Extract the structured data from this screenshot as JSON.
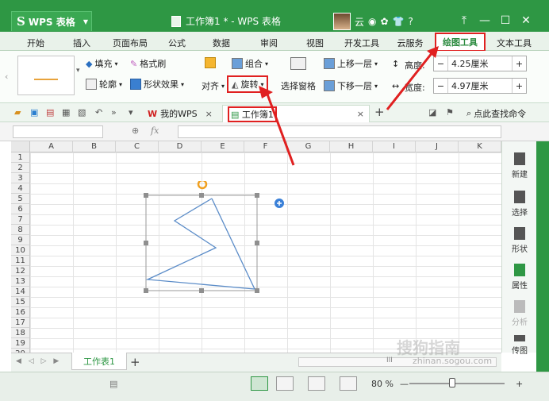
{
  "titlebar": {
    "app_name": "WPS 表格",
    "doc_title": "工作簿1 * - WPS 表格",
    "user_name": "云",
    "help": "?",
    "minimize": "—",
    "maximize": "☐",
    "close": "✕"
  },
  "tabs": [
    "开始",
    "插入",
    "页面布局",
    "公式",
    "数据",
    "审阅",
    "视图",
    "开发工具",
    "云服务",
    "绘图工具",
    "文本工具"
  ],
  "active_tab": "绘图工具",
  "ribbon": {
    "fill": "填充",
    "format_brush": "格式刷",
    "outline": "轮廓",
    "shape_effect": "形状效果",
    "align": "对齐",
    "group": "组合",
    "rotate": "旋转",
    "selection_pane": "选择窗格",
    "bring_forward": "上移一层",
    "send_backward": "下移一层",
    "height_label": "高度:",
    "height_value": "4.25厘米",
    "width_label": "宽度:",
    "width_value": "4.97厘米",
    "minus": "−",
    "plus": "+"
  },
  "doctabs": {
    "my_wps": "我的WPS",
    "workbook": "工作簿1",
    "close": "×",
    "add": "+",
    "search": "点此查找命令"
  },
  "formula": {
    "fx": "fx"
  },
  "columns": [
    "A",
    "B",
    "C",
    "D",
    "E",
    "F",
    "G",
    "H",
    "I",
    "J",
    "K"
  ],
  "rows": [
    "1",
    "2",
    "3",
    "4",
    "5",
    "6",
    "7",
    "8",
    "9",
    "10",
    "11",
    "12",
    "13",
    "14",
    "15",
    "16",
    "17",
    "18",
    "19",
    "20"
  ],
  "sidepanel": [
    "新建",
    "选择",
    "形状",
    "属性",
    "分析",
    "传图"
  ],
  "sheet_tabs": {
    "sheet1": "工作表1",
    "add": "+",
    "nav": "◀ ◁ ▷ ▶",
    "scroll_mark": "III"
  },
  "status": {
    "zoom": "80 %",
    "minus": "—",
    "plus": "+"
  },
  "watermark": {
    "brand": "搜狗指南",
    "url": "zhinan.sogou.com"
  },
  "colors": {
    "title_green": "#2e9744",
    "highlight_red": "#e02020",
    "shape_line": "#5b8cc8",
    "rotate_handle": "#f0a020"
  }
}
